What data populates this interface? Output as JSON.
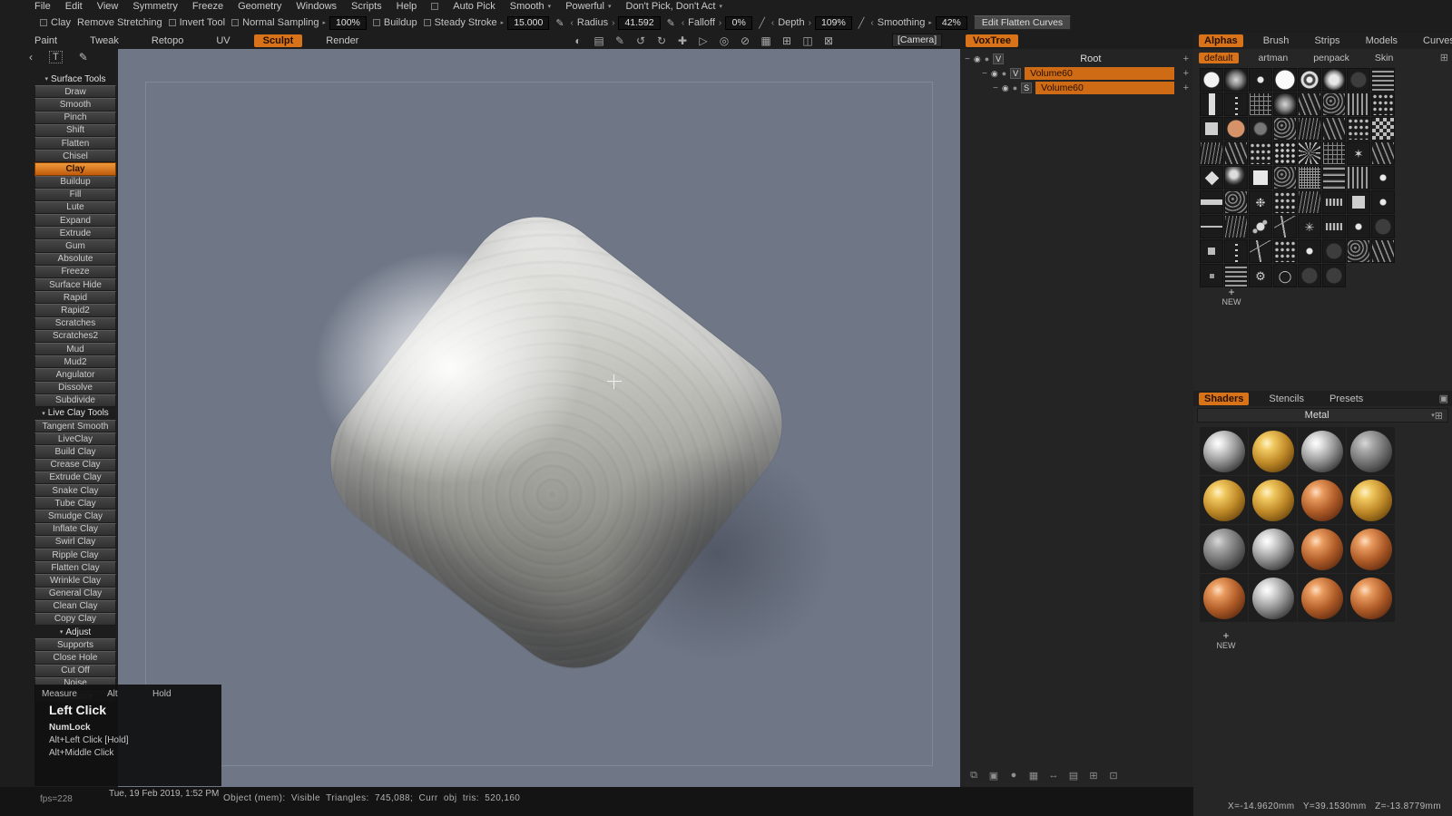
{
  "icons": {
    "tri_down": "▾",
    "tri_right": "▸",
    "angle_l": "‹",
    "angle_r": "›",
    "pen": "✎",
    "slash": "╱",
    "plus": "+",
    "minus": "−",
    "eye": "◉",
    "sphere": "●",
    "chevron_left": "‹",
    "text_tool": "T",
    "panel_icon": "▣",
    "grid_icon": "⊞"
  },
  "menubar": {
    "items": [
      "File",
      "Edit",
      "View",
      "Symmetry",
      "Freeze",
      "Geometry",
      "Windows",
      "Scripts",
      "Help"
    ],
    "auto_pick": "Auto Pick",
    "smooth": "Smooth",
    "powerful": "Powerful",
    "dont_pick_act": "Don't Pick, Don't Act"
  },
  "options_bar": {
    "clay": "Clay",
    "remove_stretching": "Remove Stretching",
    "invert_tool": "Invert Tool",
    "normal_sampling": "Normal Sampling",
    "normal_sampling_value": "100%",
    "buildup": "Buildup",
    "steady_stroke": "Steady Stroke",
    "steady_stroke_value": "15.000",
    "radius": "Radius",
    "radius_value": "41.592",
    "falloff": "Falloff",
    "falloff_value": "0%",
    "depth": "Depth",
    "depth_value": "109%",
    "smoothing": "Smoothing",
    "smoothing_value": "42%",
    "edit_flatten_curves": "Edit Flatten Curves"
  },
  "room_tabs": {
    "items": [
      {
        "label": "Paint",
        "n": "tab-paint"
      },
      {
        "label": "Tweak",
        "n": "tab-tweak"
      },
      {
        "label": "Retopo",
        "n": "tab-retopo"
      },
      {
        "label": "UV",
        "n": "tab-uv"
      },
      {
        "label": "Sculpt",
        "cls": "active",
        "n": "tab-sculpt"
      },
      {
        "label": "Render",
        "n": "tab-render"
      }
    ],
    "camera": "[Camera]"
  },
  "viewport_icons": [
    {
      "g": "◐",
      "n": "shading-mode-icon"
    },
    {
      "g": "▤",
      "n": "environment-panel-icon"
    },
    {
      "g": "✎",
      "n": "edit-curves-icon"
    },
    {
      "g": "↺",
      "n": "rotate-ccw-icon"
    },
    {
      "g": "↻",
      "n": "rotate-cw-icon"
    },
    {
      "g": "✚",
      "n": "transform-gizmo-icon"
    },
    {
      "g": "▷",
      "n": "play-icon"
    },
    {
      "g": "◎",
      "n": "focus-icon"
    },
    {
      "g": "⊘",
      "n": "backface-culling-icon"
    },
    {
      "g": "▦",
      "n": "wire-grid-icon"
    },
    {
      "g": "⊞",
      "n": "add-viewport-icon"
    },
    {
      "g": "◫",
      "n": "split-view-icon"
    },
    {
      "g": "⊠",
      "n": "close-viewport-icon"
    }
  ],
  "tool_list": {
    "items": [
      {
        "label": "Surface Tools",
        "cls": "header",
        "g": "▾",
        "n": "section-surface-tools"
      },
      {
        "label": "Draw",
        "cls": "tool"
      },
      {
        "label": "Smooth",
        "cls": "tool"
      },
      {
        "label": "Pinch",
        "cls": "tool"
      },
      {
        "label": "Shift",
        "cls": "tool"
      },
      {
        "label": "Flatten",
        "cls": "tool"
      },
      {
        "label": "Chisel",
        "cls": "tool"
      },
      {
        "label": "Clay",
        "cls": "tool selected",
        "n": "tool-button-clay"
      },
      {
        "label": "Buildup",
        "cls": "tool"
      },
      {
        "label": "Fill",
        "cls": "tool"
      },
      {
        "label": "Lute",
        "cls": "tool"
      },
      {
        "label": "Expand",
        "cls": "tool"
      },
      {
        "label": "Extrude",
        "cls": "tool"
      },
      {
        "label": "Gum",
        "cls": "tool"
      },
      {
        "label": "Absolute",
        "cls": "tool"
      },
      {
        "label": "Freeze",
        "cls": "tool"
      },
      {
        "label": "Surface Hide",
        "cls": "tool"
      },
      {
        "label": "Rapid",
        "cls": "tool"
      },
      {
        "label": "Rapid2",
        "cls": "tool"
      },
      {
        "label": "Scratches",
        "cls": "tool"
      },
      {
        "label": "Scratches2",
        "cls": "tool"
      },
      {
        "label": "Mud",
        "cls": "tool"
      },
      {
        "label": "Mud2",
        "cls": "tool"
      },
      {
        "label": "Angulator",
        "cls": "tool"
      },
      {
        "label": "Dissolve",
        "cls": "tool"
      },
      {
        "label": "Subdivide",
        "cls": "tool"
      },
      {
        "label": "Live Clay Tools",
        "cls": "header",
        "g": "▾",
        "n": "section-live-clay-tools"
      },
      {
        "label": "Tangent Smooth",
        "cls": "tool"
      },
      {
        "label": "LiveClay",
        "cls": "tool"
      },
      {
        "label": "Build Clay",
        "cls": "tool"
      },
      {
        "label": "Crease Clay",
        "cls": "tool"
      },
      {
        "label": "Extrude Clay",
        "cls": "tool"
      },
      {
        "label": "Snake Clay",
        "cls": "tool"
      },
      {
        "label": "Tube Clay",
        "cls": "tool"
      },
      {
        "label": "Smudge Clay",
        "cls": "tool"
      },
      {
        "label": "Inflate Clay",
        "cls": "tool"
      },
      {
        "label": "Swirl Clay",
        "cls": "tool"
      },
      {
        "label": "Ripple Clay",
        "cls": "tool"
      },
      {
        "label": "Flatten Clay",
        "cls": "tool"
      },
      {
        "label": "Wrinkle Clay",
        "cls": "tool"
      },
      {
        "label": "General Clay",
        "cls": "tool"
      },
      {
        "label": "Clean Clay",
        "cls": "tool"
      },
      {
        "label": "Copy Clay",
        "cls": "tool"
      },
      {
        "label": "Adjust",
        "cls": "header",
        "g": "▾",
        "n": "section-adjust"
      },
      {
        "label": "Supports",
        "cls": "tool"
      },
      {
        "label": "Close Hole",
        "cls": "tool"
      },
      {
        "label": "Cut Off",
        "cls": "tool"
      },
      {
        "label": "Noise",
        "cls": "tool"
      },
      {
        "label": "Measure",
        "cls": "tool"
      }
    ]
  },
  "hotkey_popup": {
    "tool_row": {
      "action": "Measure",
      "key1": "Alt",
      "key2": "Hold"
    },
    "title": "Left Click",
    "entries": [
      {
        "label": "NumLock",
        "cls": "strong"
      },
      {
        "label": "Alt+Left Click [Hold]"
      },
      {
        "label": "Alt+Middle Click"
      }
    ]
  },
  "voxtree": {
    "tab": "VoxTree",
    "root_label": "Root",
    "root_badge": "V",
    "volumes": [
      {
        "badge": "V",
        "label": "Volume60",
        "cls": "ind1"
      },
      {
        "badge": "S",
        "label": "Volume60",
        "cls": "ind2"
      }
    ]
  },
  "voxtree_footer_icons": [
    {
      "g": "⧉",
      "n": "duplicate-volume-icon"
    },
    {
      "g": "▣",
      "n": "bake-icon"
    },
    {
      "g": "●",
      "n": "merge-icon"
    },
    {
      "g": "▦",
      "n": "voxelize-icon"
    },
    {
      "g": "↔",
      "n": "swap-icon"
    },
    {
      "g": "▤",
      "n": "layers-icon"
    },
    {
      "g": "⊞",
      "n": "add-volume-icon"
    },
    {
      "g": "⊡",
      "n": "frame-icon"
    }
  ],
  "alpha_panel": {
    "tabs": [
      {
        "label": "Alphas",
        "cls": "active",
        "n": "tab-alphas"
      },
      {
        "label": "Brush",
        "n": "tab-brush"
      },
      {
        "label": "Strips",
        "n": "tab-strips"
      },
      {
        "label": "Models",
        "n": "tab-models"
      },
      {
        "label": "Curves",
        "n": "tab-curves"
      }
    ],
    "subtabs": [
      {
        "label": "default",
        "cls": "active",
        "n": "subtab-default"
      },
      {
        "label": "artman",
        "n": "subtab-artman"
      },
      {
        "label": "penpack",
        "n": "subtab-penpack"
      },
      {
        "label": "Skin",
        "n": "subtab-skin"
      }
    ],
    "new_label": "NEW",
    "cells": [
      {
        "cls": "a-disc"
      },
      {
        "cls": "a-soft"
      },
      {
        "cls": "a-dot"
      },
      {
        "cls": "a-discbig"
      },
      {
        "cls": "a-ring2"
      },
      {
        "cls": "a-discsoft"
      },
      {
        "cls": "a-faint"
      },
      {
        "cls": "a-hlines"
      },
      {
        "cls": "a-vbar"
      },
      {
        "cls": "a-dotcol"
      },
      {
        "cls": "a-grid"
      },
      {
        "cls": "a-soft"
      },
      {
        "cls": "a-streak"
      },
      {
        "cls": "a-noise"
      },
      {
        "cls": "a-vlines"
      },
      {
        "cls": "a-spray"
      },
      {
        "cls": "a-square"
      },
      {
        "cls": "a-skin"
      },
      {
        "cls": "a-darkdot"
      },
      {
        "cls": "a-noise"
      },
      {
        "cls": "a-fiber"
      },
      {
        "cls": "a-streak"
      },
      {
        "cls": "a-spray"
      },
      {
        "cls": "a-checker"
      },
      {
        "cls": "a-fiber"
      },
      {
        "cls": "a-streak"
      },
      {
        "cls": "a-spray"
      },
      {
        "cls": "a-dotgrid"
      },
      {
        "cls": "a-rays"
      },
      {
        "cls": "a-grid"
      },
      {
        "g": "✶",
        "cls": "a-glyphcell"
      },
      {
        "cls": "a-streak"
      },
      {
        "cls": "a-diamond"
      },
      {
        "cls": "a-dotsphere"
      },
      {
        "cls": "a-sqlight"
      },
      {
        "cls": "a-noise"
      },
      {
        "cls": "a-densegrid"
      },
      {
        "cls": "a-waves"
      },
      {
        "cls": "a-vlines"
      },
      {
        "cls": "a-dot"
      },
      {
        "cls": "a-hbar"
      },
      {
        "cls": "a-noise"
      },
      {
        "g": "❉",
        "cls": "a-glyphcell"
      },
      {
        "cls": "a-spray"
      },
      {
        "cls": "a-fiber"
      },
      {
        "cls": "a-coil"
      },
      {
        "cls": "a-square"
      },
      {
        "cls": "a-dot"
      },
      {
        "cls": "a-thinbar"
      },
      {
        "cls": "a-fiber"
      },
      {
        "cls": "a-splash"
      },
      {
        "cls": "a-branch"
      },
      {
        "g": "✳",
        "cls": "a-glyphcell"
      },
      {
        "cls": "a-coil"
      },
      {
        "cls": "a-dot"
      },
      {
        "cls": "a-faint"
      },
      {
        "cls": "a-small"
      },
      {
        "cls": "a-dotcol"
      },
      {
        "cls": "a-branch"
      },
      {
        "cls": "a-spray"
      },
      {
        "cls": "a-dot"
      },
      {
        "cls": "a-faint"
      },
      {
        "cls": "a-noise"
      },
      {
        "cls": "a-streak"
      },
      {
        "cls": "a-tiny"
      },
      {
        "cls": "a-hlines"
      },
      {
        "g": "⚙",
        "cls": "a-glyphcell"
      },
      {
        "g": "◯",
        "cls": "a-glyphcell"
      },
      {
        "cls": "a-faint"
      },
      {
        "cls": "a-faint"
      }
    ]
  },
  "shader_panel": {
    "tabs": [
      {
        "label": "Shaders",
        "cls": "active",
        "n": "tab-shaders"
      },
      {
        "label": "Stencils",
        "n": "tab-stencils"
      },
      {
        "label": "Presets",
        "n": "tab-presets"
      }
    ],
    "category": "Metal",
    "new_label": "NEW",
    "spheres": [
      {
        "cls": "s-chrome"
      },
      {
        "cls": "s-gold"
      },
      {
        "cls": "s-chrome"
      },
      {
        "cls": "s-steel"
      },
      {
        "cls": "s-gold"
      },
      {
        "cls": "s-gold"
      },
      {
        "cls": "s-copper"
      },
      {
        "cls": "s-gold"
      },
      {
        "cls": "s-steel"
      },
      {
        "cls": "s-chrome"
      },
      {
        "cls": "s-copper"
      },
      {
        "cls": "s-copper"
      },
      {
        "cls": "s-copper"
      },
      {
        "cls": "s-chrome"
      },
      {
        "cls": "s-copper"
      },
      {
        "cls": "s-copper"
      }
    ]
  },
  "status_bar": {
    "fps": "fps=228",
    "date": "Tue, 19 Feb 2019, 1:52 PM",
    "stats": "Object (mem):  Visible  Triangles:  745,088;  Curr  obj  tris:  520,160",
    "coords": "X=-14.9620mm   Y=39.1530mm   Z=-13.8779mm"
  }
}
